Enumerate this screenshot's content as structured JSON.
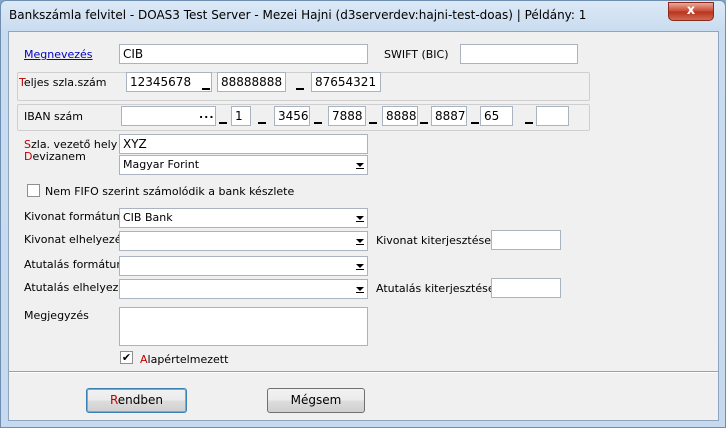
{
  "window": {
    "title": "Bankszámla felvitel - DOAS3 Test Server - Mezei Hajni (d3serverdev:hajni-test-doas) | Példány: 1",
    "close_glyph": "x"
  },
  "fields": {
    "megnevezes": {
      "label": "Megnevezés",
      "value": "CIB"
    },
    "swift": {
      "label": "SWIFT (BIC)",
      "value": ""
    },
    "szlaszam": {
      "label_first": "T",
      "label_rest": "eljes szla.szám",
      "parts": [
        "12345678",
        "88888888",
        "87654321"
      ]
    },
    "iban": {
      "label": "IBAN szám",
      "country": "",
      "dots": "...",
      "parts": [
        "1",
        "3456",
        "7888",
        "8888",
        "8887",
        "65",
        ""
      ]
    },
    "vezeto_hely": {
      "label_first": "S",
      "label_rest": "zla. vezető hely",
      "value": "XYZ"
    },
    "devizanem": {
      "label_first": "D",
      "label_rest": "evizanem",
      "value": "Magyar Forint"
    },
    "nem_fifo": {
      "label": "Nem FIFO szerint számolódik a bank készlete",
      "checked": false
    },
    "kivonat_formatum": {
      "label": "Kivonat formátum",
      "value": "CIB Bank"
    },
    "kivonat_elhelyezes": {
      "label": "Kivonat elhelyezése",
      "value": ""
    },
    "kivonat_kiterjesztes": {
      "label": "Kivonat kiterjesztése:",
      "value": ""
    },
    "atutalas_formatum": {
      "label": "Atutalás formátum",
      "value": ""
    },
    "atutalas_elhelyezes": {
      "label": "Atutalás elhelyezés",
      "value": ""
    },
    "atutalas_kiterjesztes": {
      "label": "Atutalás kiterjesztése:",
      "value": ""
    },
    "megjegyzes": {
      "label": "Megjegyzés",
      "value": ""
    },
    "alapertelmezett": {
      "label_first": "A",
      "label_rest": "lapértelmezett",
      "checked": true,
      "check_glyph": "✔"
    }
  },
  "buttons": {
    "ok": {
      "label_first": "R",
      "label_rest": "endben"
    },
    "cancel": {
      "label": "Mégsem"
    }
  }
}
